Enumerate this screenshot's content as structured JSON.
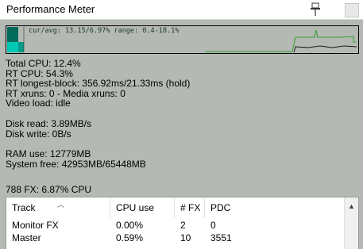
{
  "window": {
    "title": "Performance Meter"
  },
  "meter": {
    "label": "cur/avg: 13.15/6.97%  range: 0.4-18.1%",
    "colors": {
      "bar_dark": "#006b5a",
      "bar_light": "#00c8b4",
      "cpu_line": "#2ea02e",
      "rt_line": "#1a1a1a"
    }
  },
  "stats": {
    "total_cpu": "Total CPU: 12.4%",
    "rt_cpu": "RT CPU: 54.3%",
    "rt_longest_block": "RT longest-block: 356.92ms/21.33ms (hold)",
    "rt_xruns": "RT xruns: 0 - Media xruns: 0",
    "video_load": "Video load: idle",
    "disk_read": "Disk read: 3.89MB/s",
    "disk_write": "Disk write: 0B/s",
    "ram_use": "RAM use: 12779MB",
    "system_free": "System free: 42953MB/65448MB"
  },
  "fx_summary": "788 FX: 6.87% CPU",
  "table": {
    "columns": [
      "Track",
      "CPU use",
      "# FX",
      "PDC"
    ],
    "rows": [
      {
        "track": "Monitor FX",
        "cpu": "0.00%",
        "fx": "2",
        "pdc": "0"
      },
      {
        "track": "Master",
        "cpu": "0.59%",
        "fx": "10",
        "pdc": "3551"
      }
    ]
  }
}
